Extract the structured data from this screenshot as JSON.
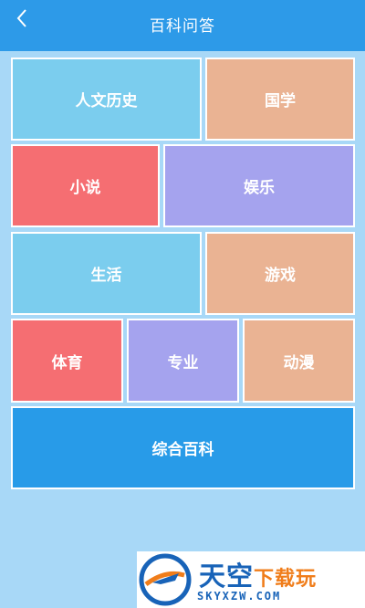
{
  "header": {
    "title": "百科问答",
    "back_icon": "chevron-left-icon"
  },
  "tiles": [
    {
      "label": "人文历史",
      "color": "#7bcdee"
    },
    {
      "label": "国学",
      "color": "#eab393"
    },
    {
      "label": "小说",
      "color": "#f56e72"
    },
    {
      "label": "娱乐",
      "color": "#a5a3ee"
    },
    {
      "label": "生活",
      "color": "#7bcdee"
    },
    {
      "label": "游戏",
      "color": "#eab393"
    },
    {
      "label": "体育",
      "color": "#f56e72"
    },
    {
      "label": "专业",
      "color": "#a5a3ee"
    },
    {
      "label": "动漫",
      "color": "#eab393"
    },
    {
      "label": "综合百科",
      "color": "#289be8"
    }
  ],
  "watermark": {
    "brand": "天空",
    "brand_accent": "下载玩",
    "domain": "SKYXZW.COM"
  }
}
